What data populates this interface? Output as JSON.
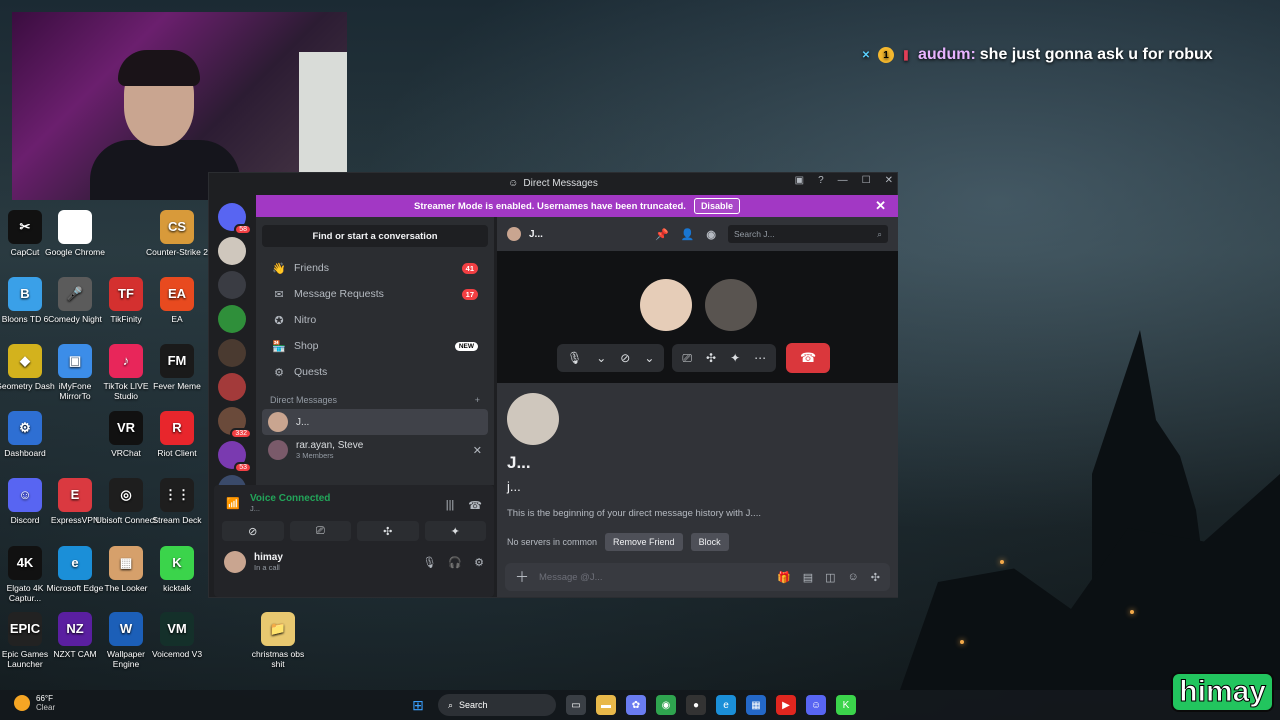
{
  "desktop": {
    "icons": [
      {
        "label": "CapCut",
        "color": "#111111",
        "glyph": "✂"
      },
      {
        "label": "Google Chrome",
        "color": "#ffffff",
        "glyph": ""
      },
      {
        "label": "Counter-Strike 2",
        "color": "#d89a3a",
        "glyph": "CS"
      },
      {
        "label": "Bloons TD 6",
        "color": "#3aa0e8",
        "glyph": "B"
      },
      {
        "label": "Comedy Night",
        "color": "#5b5b5b",
        "glyph": "🎤"
      },
      {
        "label": "TikFinity",
        "color": "#d4302f",
        "glyph": "TF"
      },
      {
        "label": "EA",
        "color": "#e84a1f",
        "glyph": "EA"
      },
      {
        "label": "Geometry Dash",
        "color": "#d3b21d",
        "glyph": "◆"
      },
      {
        "label": "iMyFone MirrorTo",
        "color": "#3c8de8",
        "glyph": "▣"
      },
      {
        "label": "TikTok LIVE Studio",
        "color": "#e8265a",
        "glyph": "♪"
      },
      {
        "label": "Fever Meme",
        "color": "#1a1a1a",
        "glyph": "FM"
      },
      {
        "label": "Dashboard",
        "color": "#2e6fd3",
        "glyph": "⚙"
      },
      {
        "label": "VRChat",
        "color": "#111111",
        "glyph": "VR"
      },
      {
        "label": "Riot Client",
        "color": "#e8262c",
        "glyph": "R"
      },
      {
        "label": "Discord",
        "color": "#5865f2",
        "glyph": "☺"
      },
      {
        "label": "ExpressVPN",
        "color": "#da3940",
        "glyph": "E"
      },
      {
        "label": "Ubisoft Connect",
        "color": "#1e1e1e",
        "glyph": "◎"
      },
      {
        "label": "Stream Deck",
        "color": "#1e1e1e",
        "glyph": "⋮⋮"
      },
      {
        "label": "Elgato 4K Captur...",
        "color": "#111111",
        "glyph": "4K"
      },
      {
        "label": "Microsoft Edge",
        "color": "#1b8fd8",
        "glyph": "e"
      },
      {
        "label": "The Looker",
        "color": "#d6a06b",
        "glyph": "▦"
      },
      {
        "label": "kicktalk",
        "color": "#3bd44b",
        "glyph": "K"
      },
      {
        "label": "Epic Games Launcher",
        "color": "#222222",
        "glyph": "EPIC"
      },
      {
        "label": "NZXT CAM",
        "color": "#5a1fa0",
        "glyph": "NZ"
      },
      {
        "label": "Wallpaper Engine",
        "color": "#1c5fb8",
        "glyph": "W"
      },
      {
        "label": "Voicemod V3",
        "color": "#14302a",
        "glyph": "VM"
      },
      {
        "label": "christmas obs shit",
        "color": "#e8c870",
        "glyph": "📁"
      }
    ]
  },
  "chat_overlay": {
    "username": "audum:",
    "message": "she just gonna ask u for robux"
  },
  "window": {
    "title": "Direct Messages",
    "streamer_banner": "Streamer Mode is enabled. Usernames have been truncated.",
    "disable_label": "Disable"
  },
  "servers": [
    {
      "badge": "58"
    },
    {
      "badge": ""
    },
    {
      "badge": ""
    },
    {
      "badge": ""
    },
    {
      "badge": ""
    },
    {
      "badge": ""
    },
    {
      "badge": "332"
    },
    {
      "badge": "53"
    },
    {
      "badge": "NEW"
    }
  ],
  "sidebar": {
    "find_label": "Find or start a conversation",
    "nav": [
      {
        "icon": "friends-icon",
        "glyph": "👋",
        "label": "Friends",
        "count": "41",
        "tag": ""
      },
      {
        "icon": "envelope-icon",
        "glyph": "✉",
        "label": "Message Requests",
        "count": "17",
        "tag": ""
      },
      {
        "icon": "nitro-icon",
        "glyph": "✪",
        "label": "Nitro",
        "count": "",
        "tag": ""
      },
      {
        "icon": "shop-icon",
        "glyph": "🏪",
        "label": "Shop",
        "count": "",
        "tag": "NEW"
      },
      {
        "icon": "quests-icon",
        "glyph": "⚙",
        "label": "Quests",
        "count": "",
        "tag": ""
      }
    ],
    "dm_header": "Direct Messages",
    "dms": [
      {
        "name": "J...",
        "sub": ""
      },
      {
        "name": "rar.ayan, Steve",
        "sub": "3 Members"
      }
    ]
  },
  "voice": {
    "status": "Voice Connected",
    "channel": "J..."
  },
  "user": {
    "name": "himay",
    "status": "In a call"
  },
  "main": {
    "header_name": "J...",
    "search_placeholder": "Search J...",
    "intro_name_large": "J...",
    "intro_name_small": "j...",
    "begin_text": "This is the beginning of your direct message history with J....",
    "no_servers": "No servers in common",
    "remove_friend": "Remove Friend",
    "block": "Block",
    "composer_placeholder": "Message @J..."
  },
  "taskbar": {
    "weather_temp": "66°F",
    "weather_desc": "Clear",
    "search_label": "Search"
  },
  "brand_text": "himay"
}
